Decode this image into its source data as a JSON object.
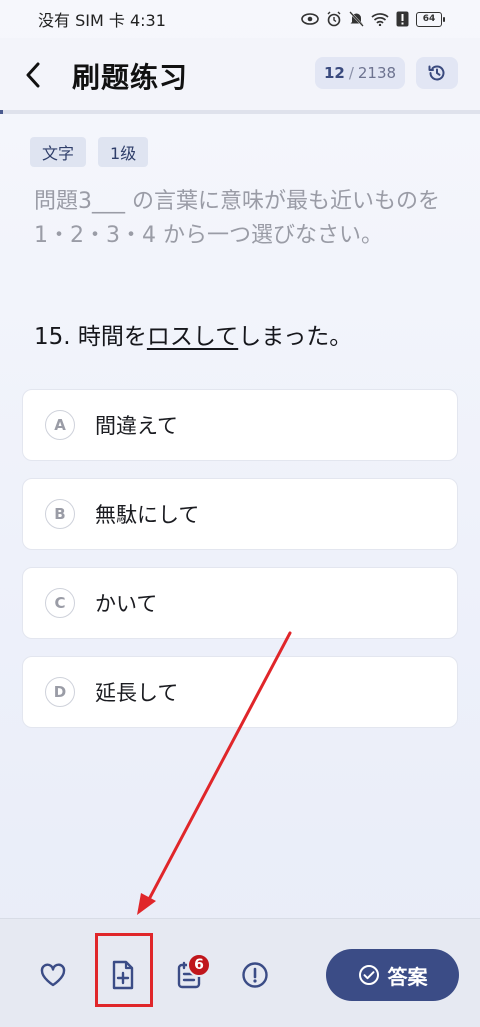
{
  "status_bar": {
    "carrier_time": "没有 SIM 卡 4:31",
    "battery": "64",
    "icons": [
      "eye-icon",
      "alarm-icon",
      "mute-icon",
      "wifi-icon",
      "alert-icon",
      "battery-icon"
    ]
  },
  "header": {
    "title": "刷题练习",
    "current": "12",
    "separator": "/",
    "total": "2138",
    "back_icon": "chevron-left-icon",
    "history_icon": "history-icon"
  },
  "tags": [
    "文字",
    "1级"
  ],
  "instruction": "問題3___ の言葉に意味が最も近いものを 1・2・3・4 から一つ選びなさい。",
  "question": {
    "prefix": "15. 時間を",
    "underlined": "ロスして",
    "suffix": "しまった。"
  },
  "options": [
    {
      "letter": "A",
      "text": "間違えて"
    },
    {
      "letter": "B",
      "text": "無駄にして"
    },
    {
      "letter": "C",
      "text": "かいて"
    },
    {
      "letter": "D",
      "text": "延長して"
    }
  ],
  "bottom_bar": {
    "badge_count": "6",
    "answer_label": "答案",
    "icons": [
      "heart-icon",
      "add-note-icon",
      "notes-list-icon",
      "report-icon",
      "check-circle-icon"
    ]
  },
  "colors": {
    "accent": "#3b4c86",
    "badge": "#c0161c",
    "annotation": "#e0262a"
  }
}
